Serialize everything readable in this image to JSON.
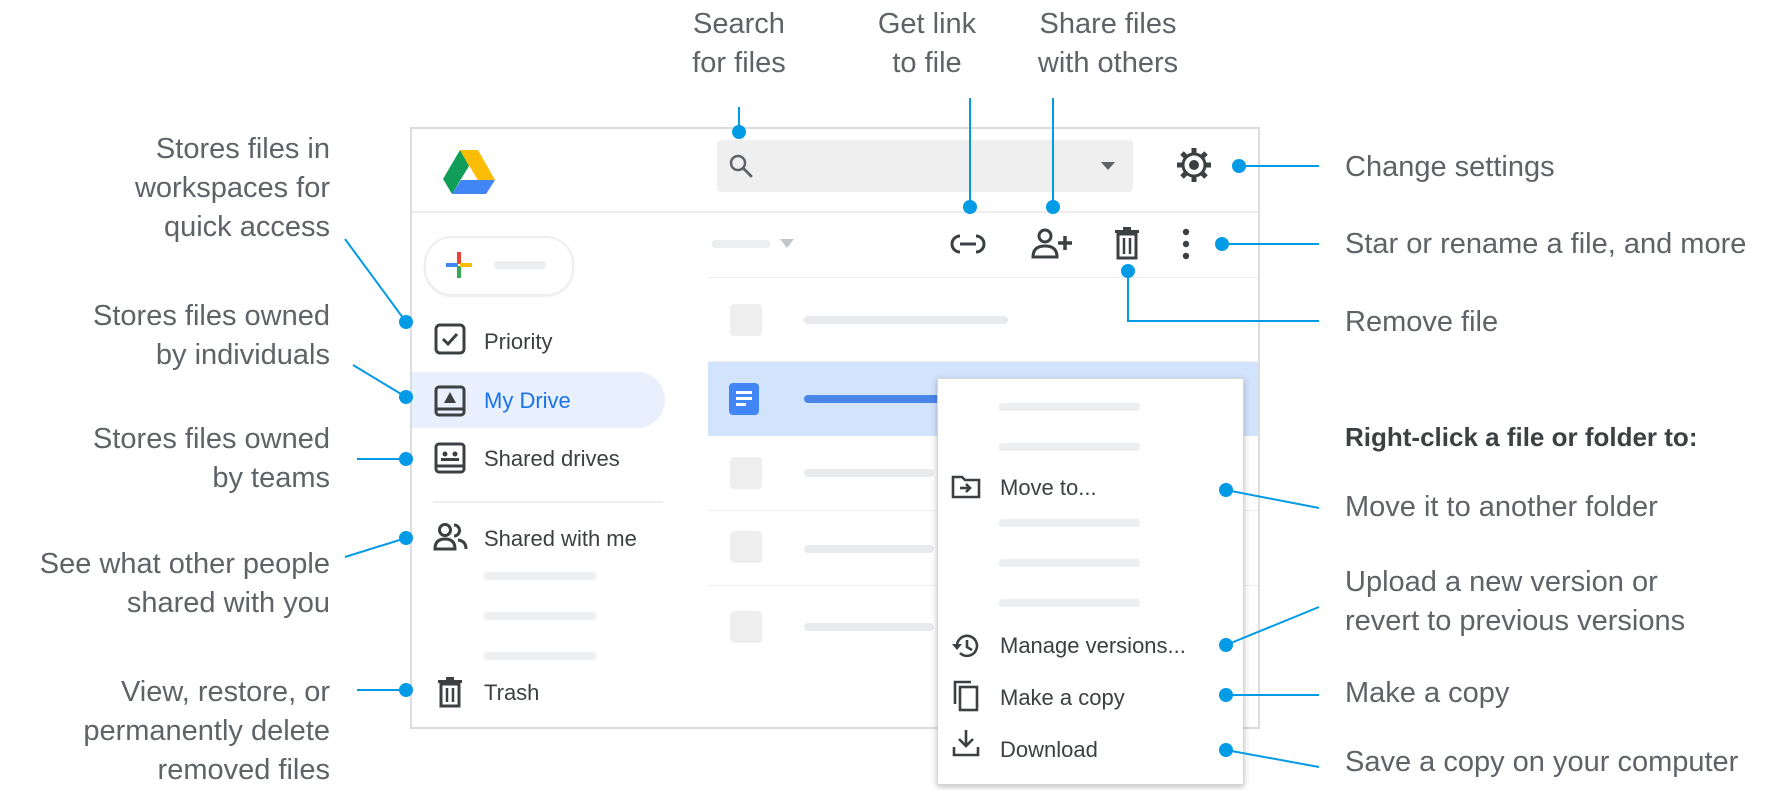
{
  "colors": {
    "accent": "#1a73e8",
    "dot": "#039be5",
    "callout_text": "#5f6368",
    "selected_bg": "#d2e3fc",
    "nav_selected_bg": "#e8f0fe"
  },
  "callouts": {
    "search": "Search\nfor files",
    "get_link": "Get link\nto file",
    "share": "Share files\nwith others",
    "change_settings": "Change settings",
    "star_rename": "Star or rename a file, and more",
    "remove_file": "Remove file",
    "workspaces": "Stores files in\nworkspaces for\nquick access",
    "individuals": "Stores files owned\nby individuals",
    "teams": "Stores files owned\nby teams",
    "shared_with_you": "See what other people\nshared with you",
    "trash": "View, restore, or\npermanently delete\nremoved files",
    "right_click_heading": "Right-click a file or folder to:",
    "move_folder": "Move it to another folder",
    "upload_version": "Upload a new version or\nrevert to previous versions",
    "make_copy": "Make a copy",
    "save_copy": "Save a copy on your computer"
  },
  "sidebar": {
    "items": [
      {
        "label": "Priority",
        "icon": "priority-check-icon"
      },
      {
        "label": "My Drive",
        "icon": "my-drive-icon",
        "selected": true
      },
      {
        "label": "Shared drives",
        "icon": "shared-drives-icon"
      },
      {
        "label": "Shared with me",
        "icon": "people-icon"
      },
      {
        "label": "Trash",
        "icon": "trash-icon"
      }
    ]
  },
  "context_menu": {
    "items": [
      {
        "label": "Move to...",
        "icon": "move-to-folder-icon"
      },
      {
        "label": "Manage versions...",
        "icon": "history-icon"
      },
      {
        "label": "Make a copy",
        "icon": "copy-icon"
      },
      {
        "label": "Download",
        "icon": "download-icon"
      }
    ]
  },
  "toolbar": {
    "icons": [
      "search-icon",
      "dropdown-arrow-icon",
      "gear-icon",
      "link-icon",
      "add-person-icon",
      "trash-icon",
      "more-vert-icon"
    ]
  }
}
